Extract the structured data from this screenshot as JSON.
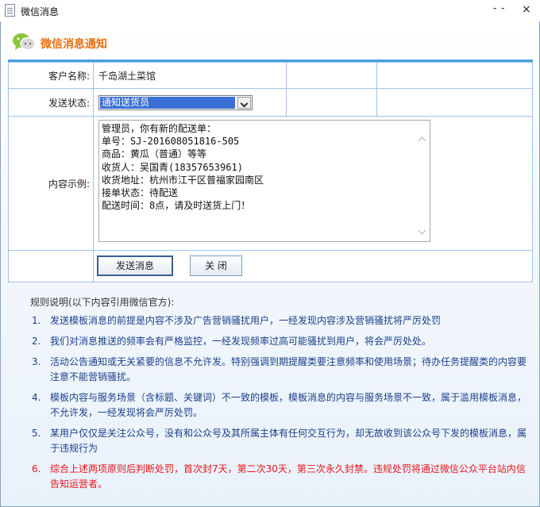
{
  "window": {
    "title": "微信消息",
    "minimize_label": "- -",
    "close_label": "×"
  },
  "header": {
    "title": "微信消息通知"
  },
  "form": {
    "customer_label": "客户名称:",
    "customer_value": "千岛湖土菜馆",
    "status_label": "发送状态:",
    "status_selected": "通知送货员",
    "content_label": "内容示例:",
    "content_lines": [
      "管理员，你有新的配送单：",
      "单号：SJ-201608051816-505",
      "商品：黄瓜（普通）等等",
      "收货人：吴国青(18357653961)",
      "收货地址：杭州市江干区普福家园南区",
      "接单状态：待配送",
      "配送时间：8点，请及时送货上门！"
    ],
    "send_button": "发送消息",
    "close_button": "关 闭"
  },
  "rules": {
    "title": "规则说明(以下内容引用微信官方):",
    "items": [
      {
        "num": "1.",
        "text": "发送模板消息的前提是内容不涉及广告营销骚扰用户，一经发现内容涉及营销骚扰将严厉处罚"
      },
      {
        "num": "2.",
        "text": "我们对消息推送的频率会有严格监控，一经发现频率过高可能骚扰到用户，将会严厉处处。"
      },
      {
        "num": "3.",
        "text": "活动公告通知或无关紧要的信息不允许发。特别强调到期提醒类要注意频率和使用场景；待办任务提醒类的内容要注意不能营销骚扰。"
      },
      {
        "num": "4.",
        "text": "模板内容与服务场景（含标题、关键词）不一致的模板，模板消息的内容与服务场景不一致，属于滥用模板消息，不允许发，一经发现将会严厉处罚。"
      },
      {
        "num": "5.",
        "text": "某用户仅仅是关注公众号，没有和公众号及其所属主体有任何交互行为，却无故收到该公众号下发的模板消息，属于违规行为"
      },
      {
        "num": "6.",
        "text": "综合上述两项原则后判断处罚，首次封7天，第二次30天，第三次永久封禁。违规处罚将通过微信公众平台站内信告知运营者。"
      }
    ]
  },
  "colors": {
    "accent_orange": "#e86f0f",
    "rule_blue": "#1a3f8a",
    "rule_red": "#e8161c",
    "select_highlight": "#3a6fd6"
  }
}
